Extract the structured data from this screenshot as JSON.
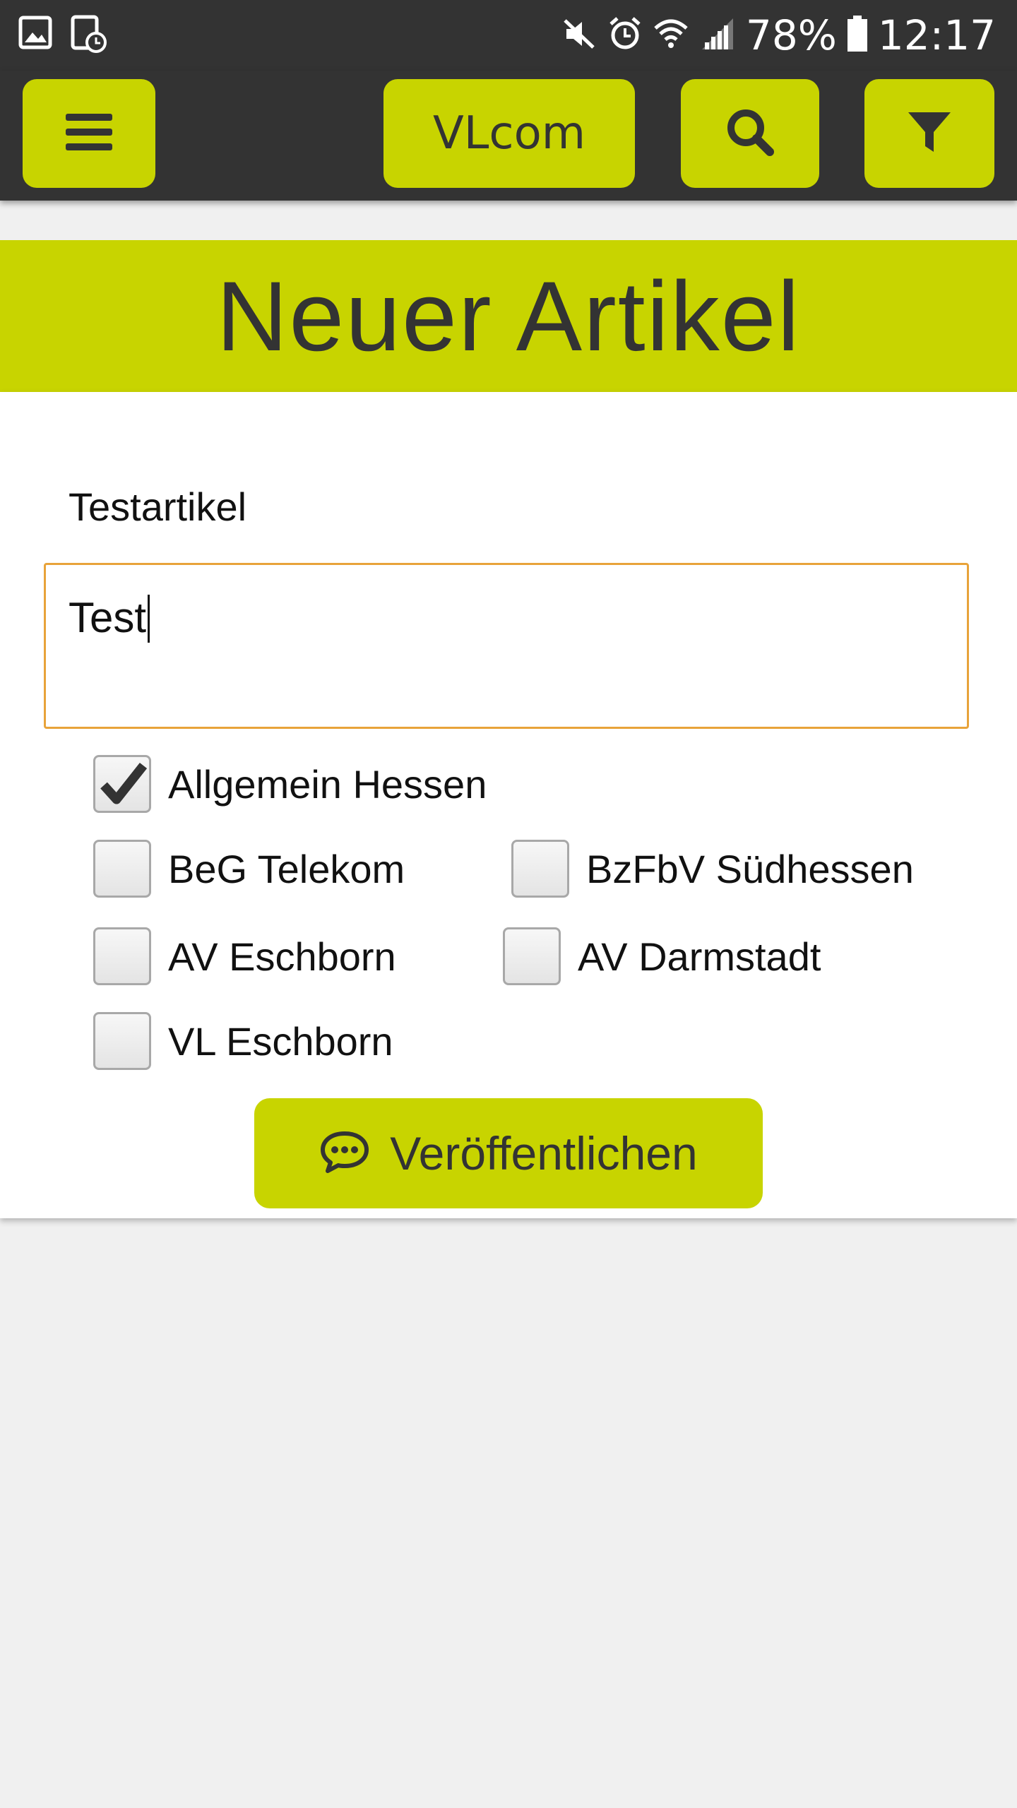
{
  "status_bar": {
    "battery": "78%",
    "time": "12:17",
    "icons": [
      "image-icon",
      "screenshot-timer-icon",
      "mute-icon",
      "alarm-icon",
      "wifi-icon",
      "signal-icon",
      "battery-icon"
    ]
  },
  "toolbar": {
    "app_button_label": "VLcom",
    "menu_icon": "hamburger-menu-icon",
    "search_icon": "search-icon",
    "filter_icon": "filter-icon"
  },
  "page": {
    "title": "Neuer Artikel"
  },
  "form": {
    "title_label": "Testartikel",
    "text_value": "Test",
    "groups": [
      {
        "label": "Allgemein Hessen",
        "checked": true
      },
      {
        "label": "BeG Telekom",
        "checked": false
      },
      {
        "label": "BzFbV Südhessen",
        "checked": false
      },
      {
        "label": "AV Eschborn",
        "checked": false
      },
      {
        "label": "AV Darmstadt",
        "checked": false
      },
      {
        "label": "VL Eschborn",
        "checked": false
      }
    ],
    "publish_label": "Veröffentlichen",
    "publish_icon": "speech-bubble-icon"
  },
  "colors": {
    "accent": "#c8d400",
    "dark": "#333333",
    "input_focus_border": "#e8a33a"
  }
}
